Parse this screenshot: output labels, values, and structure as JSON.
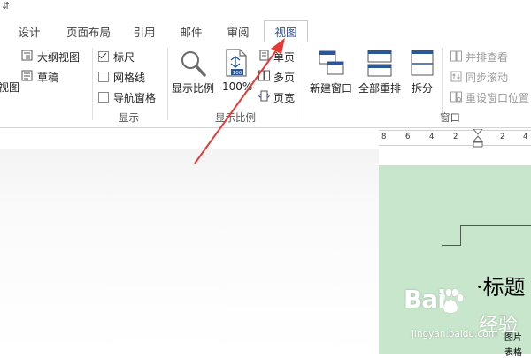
{
  "qat": {
    "symbol": "⇵"
  },
  "tabs": [
    {
      "label": "设计"
    },
    {
      "label": "页面布局"
    },
    {
      "label": "引用"
    },
    {
      "label": "邮件"
    },
    {
      "label": "审阅"
    },
    {
      "label": "视图",
      "active": true
    }
  ],
  "ribbon": {
    "views": {
      "outline_label": "大纲视图",
      "draft_label": "草稿",
      "cut_left_label": "视图"
    },
    "show": {
      "ruler_label": "标尺",
      "ruler_checked": true,
      "gridlines_label": "网格线",
      "gridlines_checked": false,
      "nav_pane_label": "导航窗格",
      "nav_pane_checked": false,
      "group_label": "显示"
    },
    "zoom": {
      "zoom_label": "显示比例",
      "hundred_label": "100%",
      "hundred_badge": "100",
      "one_page_label": "单页",
      "multi_page_label": "多页",
      "page_width_label": "页宽",
      "group_label": "显示比例"
    },
    "window": {
      "new_window_label": "新建窗口",
      "arrange_all_label": "全部重排",
      "split_label": "拆分",
      "side_by_side_label": "并排查看",
      "sync_scroll_label": "同步滚动",
      "reset_position_label": "重设窗口位置",
      "group_label": "窗口"
    }
  },
  "ruler": {
    "ticks": [
      "8",
      "6",
      "4",
      "2",
      "2",
      "4"
    ]
  },
  "document": {
    "title_text": "·标题",
    "small_line1": "图片",
    "small_line2": "表格"
  },
  "watermark": {
    "brand": "Bai",
    "brand_cn": "经验",
    "url": "jingyan.baidu.com"
  },
  "colors": {
    "accent": "#2b579a",
    "page_bg": "#c7e6cb",
    "arrow": "#e53935"
  }
}
